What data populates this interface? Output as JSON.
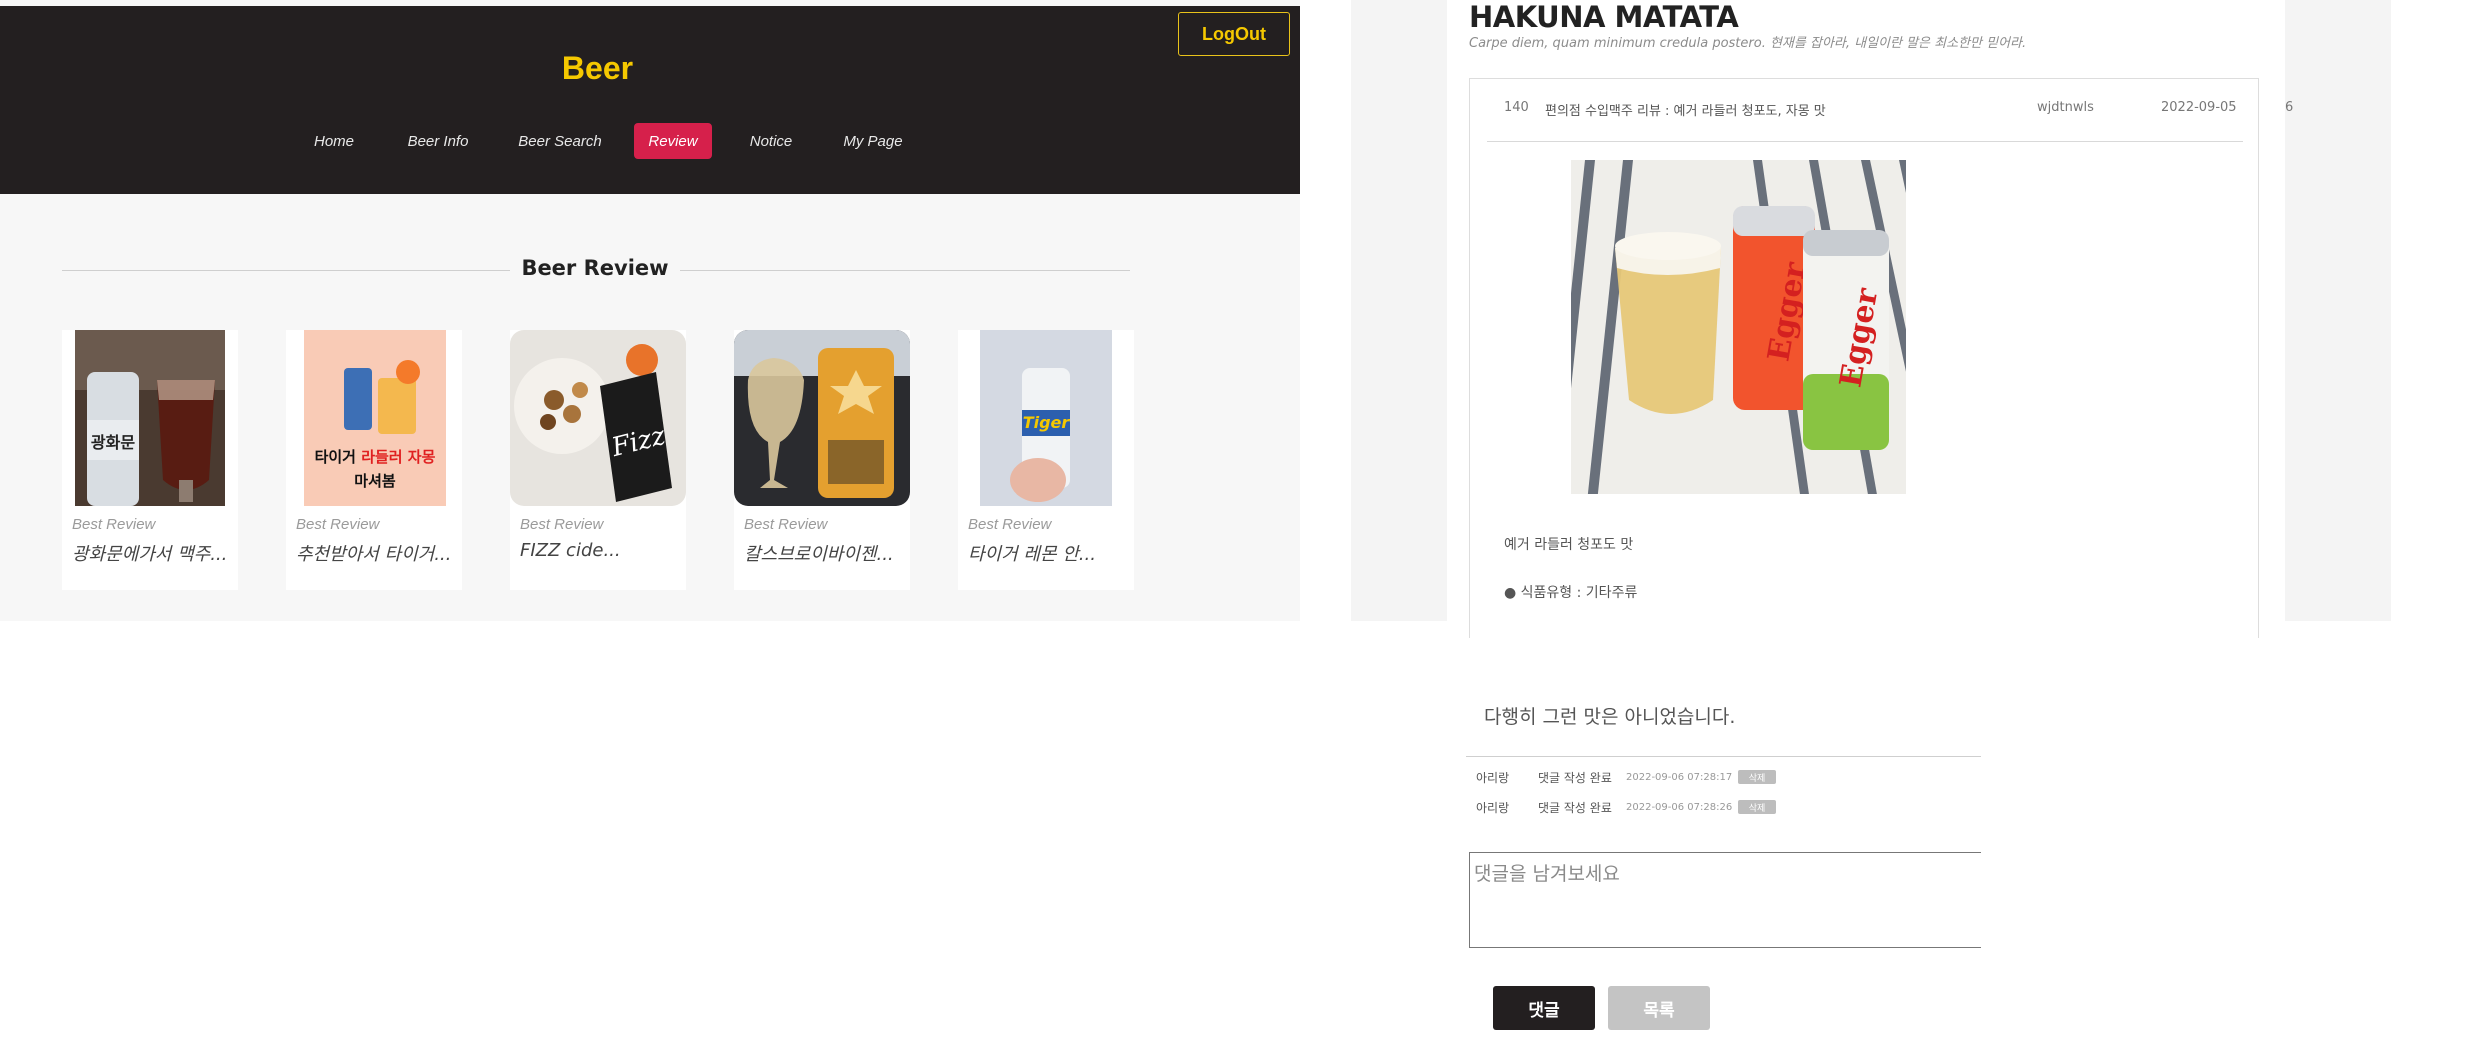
{
  "header": {
    "brand": "Beer",
    "logout_label": "LogOut",
    "nav": [
      "Home",
      "Beer Info",
      "Beer Search",
      "Review",
      "Notice",
      "My Page"
    ],
    "active_nav": "Review"
  },
  "section": {
    "title": "Beer Review"
  },
  "cards": [
    {
      "label": "Best Review",
      "title": "광화문에가서 맥주..."
    },
    {
      "label": "Best Review",
      "title": "추천받아서 타이거..."
    },
    {
      "label": "Best Review",
      "title": "FIZZ cide..."
    },
    {
      "label": "Best Review",
      "title": "칼스브로이바이젠..."
    },
    {
      "label": "Best Review",
      "title": "타이거 레몬 안..."
    }
  ],
  "post": {
    "blog_title": "HAKUNA MATATA",
    "blog_subtitle": "Carpe diem, quam minimum credula postero. 현재를 잡아라, 내일이란 말은 최소한만 믿어라.",
    "number": "140",
    "subject": "편의점 수입맥주 리뷰 : 예거 라들러 청포도, 자몽 맛",
    "author": "wjdtnwls",
    "date": "2022-09-05",
    "views": "6",
    "body_line_1": "예거 라들러 청포도 맛",
    "body_line_2": "● 식품유형 : 기타주류"
  },
  "comments": {
    "text": "다행히 그런 맛은 아니었습니다.",
    "replies": [
      {
        "author": "아리랑",
        "text": "댓글 작성 완료",
        "time": "2022-09-06 07:28:17",
        "delete": "삭제"
      },
      {
        "author": "아리랑",
        "text": "댓글 작성 완료",
        "time": "2022-09-06 07:28:26",
        "delete": "삭제"
      }
    ],
    "input_placeholder": "댓글을 남겨보세요",
    "submit_label": "댓글",
    "list_label": "목록"
  },
  "colors": {
    "header_bg": "#231f20",
    "brand_yellow": "#f5c800",
    "active_red": "#d6204b"
  }
}
